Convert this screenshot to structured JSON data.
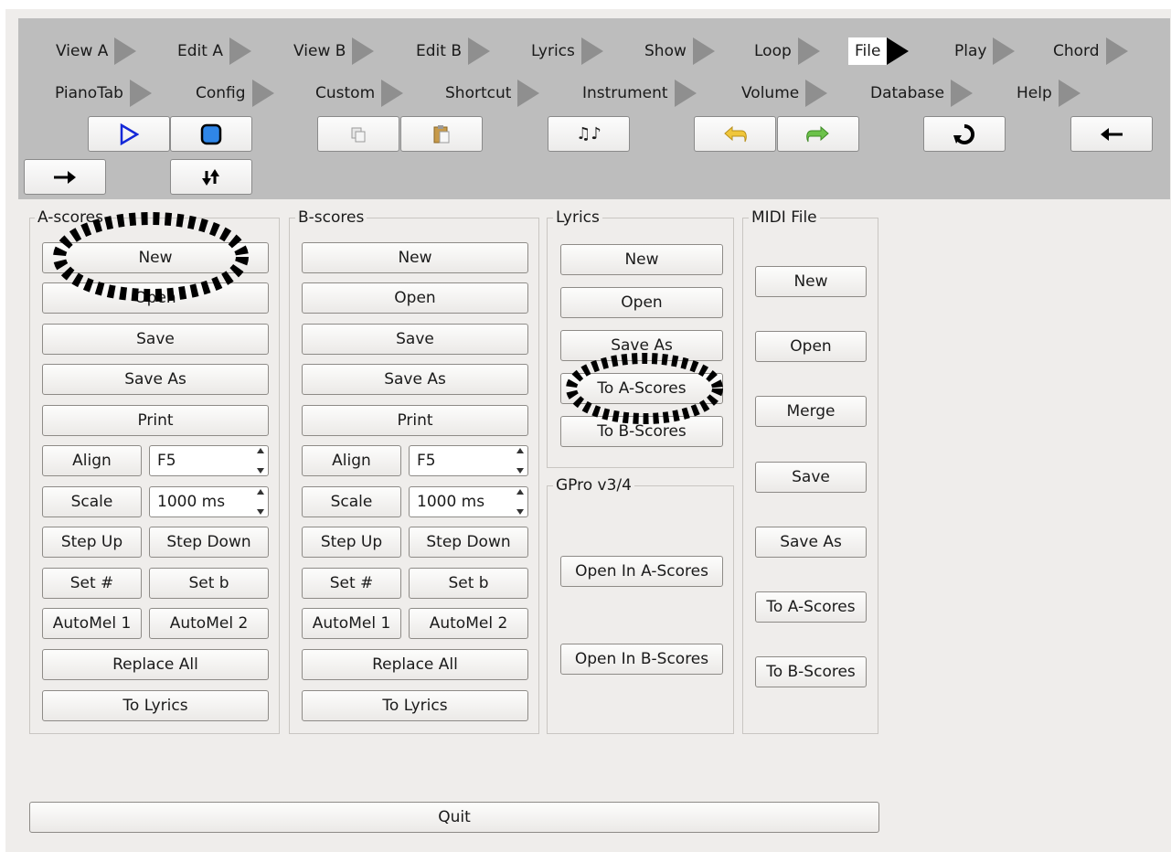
{
  "tabs": {
    "row1": [
      "View A",
      "Edit A",
      "View B",
      "Edit B",
      "Lyrics",
      "Show",
      "Loop",
      "File",
      "Play",
      "Chord"
    ],
    "row2": [
      "PianoTab",
      "Config",
      "Custom",
      "Shortcut",
      "Instrument",
      "Volume",
      "Database",
      "Help"
    ],
    "active": "File"
  },
  "icons": {
    "play": "play-icon",
    "stop": "stop-icon",
    "copy": "copy-icon",
    "paste": "paste-icon",
    "music": "music-notes-icon",
    "undo": "undo-icon",
    "redo": "redo-icon",
    "reload": "reload-icon",
    "back": "arrow-left-icon",
    "forward": "arrow-right-icon",
    "swap": "swap-arrows-icon"
  },
  "a_scores": {
    "title": "A-scores",
    "new": "New",
    "open": "Open",
    "save": "Save",
    "save_as": "Save As",
    "print": "Print",
    "align": "Align",
    "align_value": "F5",
    "scale": "Scale",
    "scale_value": "1000 ms",
    "step_up": "Step Up",
    "step_down": "Step Down",
    "set_sharp": "Set #",
    "set_flat": "Set b",
    "automel1": "AutoMel 1",
    "automel2": "AutoMel 2",
    "replace_all": "Replace All",
    "to_lyrics": "To Lyrics"
  },
  "b_scores": {
    "title": "B-scores",
    "new": "New",
    "open": "Open",
    "save": "Save",
    "save_as": "Save As",
    "print": "Print",
    "align": "Align",
    "align_value": "F5",
    "scale": "Scale",
    "scale_value": "1000 ms",
    "step_up": "Step Up",
    "step_down": "Step Down",
    "set_sharp": "Set #",
    "set_flat": "Set b",
    "automel1": "AutoMel 1",
    "automel2": "AutoMel 2",
    "replace_all": "Replace All",
    "to_lyrics": "To Lyrics"
  },
  "lyrics": {
    "title": "Lyrics",
    "new": "New",
    "open": "Open",
    "save_as": "Save As",
    "to_a": "To A-Scores",
    "to_b": "To B-Scores"
  },
  "gpro": {
    "title": "GPro v3/4",
    "open_a": "Open In A-Scores",
    "open_b": "Open In B-Scores"
  },
  "midi": {
    "title": "MIDI File",
    "new": "New",
    "open": "Open",
    "merge": "Merge",
    "save": "Save",
    "save_as": "Save As",
    "to_a": "To A-Scores",
    "to_b": "To B-Scores"
  },
  "quit": "Quit",
  "colors": {
    "toolbar_bg": "#bdbdbd",
    "window_bg": "#efedeb",
    "active_tab_arrow": "#000000",
    "tab_arrow": "#8f8f8f"
  }
}
